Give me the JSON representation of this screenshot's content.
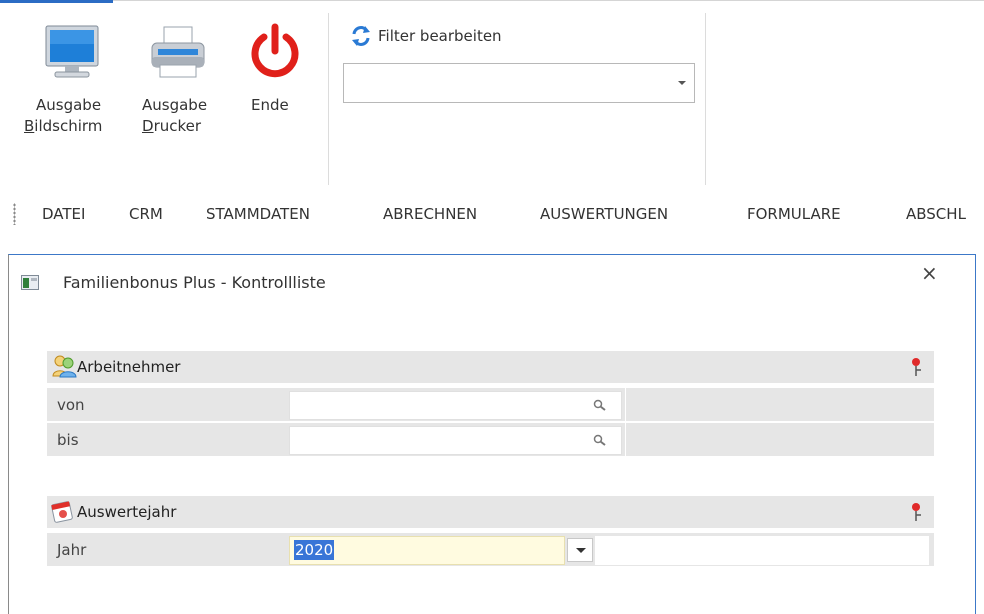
{
  "ribbon": {
    "buttons": [
      {
        "line1": "Ausgabe",
        "line2_first": "B",
        "line2_rest": "ildschirm",
        "icon": "monitor-icon"
      },
      {
        "line1": "Ausgabe",
        "line2_first": "D",
        "line2_rest": "rucker",
        "icon": "printer-icon"
      },
      {
        "line1": "Ende",
        "icon": "power-icon"
      }
    ],
    "filter": {
      "label": "Filter bearbeiten",
      "icon": "filter-refresh-icon",
      "value": ""
    }
  },
  "menu": [
    "DATEI",
    "CRM",
    "STAMMDATEN",
    "ABRECHNEN",
    "AUSWERTUNGEN",
    "FORMULARE",
    "ABSCHL"
  ],
  "dialog": {
    "title": "Familienbonus Plus - Kontrollliste",
    "close": "×",
    "groups": [
      {
        "title": "Arbeitnehmer",
        "icon": "users-icon",
        "rows": [
          {
            "label": "von",
            "value": ""
          },
          {
            "label": "bis",
            "value": ""
          }
        ]
      },
      {
        "title": "Auswertejahr",
        "icon": "calendar-icon",
        "rows": [
          {
            "label": "Jahr",
            "value": "2020"
          }
        ]
      }
    ]
  },
  "colors": {
    "accent": "#3c78c8",
    "group_bg": "#e6e6e6",
    "selection": "#3875d7",
    "active_input": "#fffbe0"
  }
}
